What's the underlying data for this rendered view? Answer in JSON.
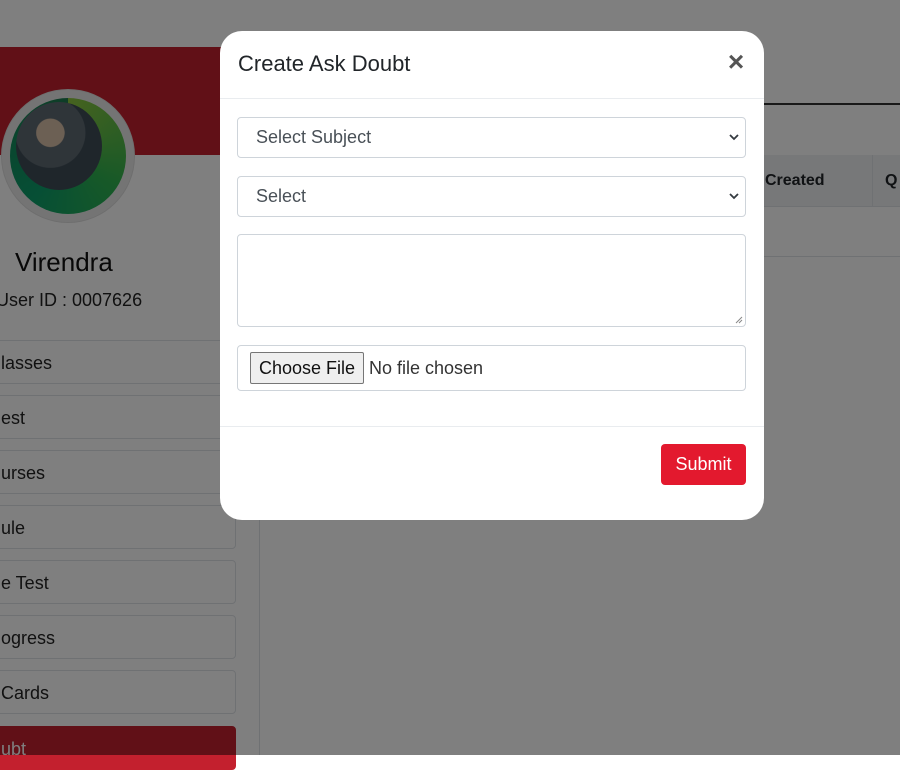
{
  "profile": {
    "name": "Virendra",
    "user_id": "User ID : 0007626"
  },
  "sidebar": {
    "items": [
      {
        "label": "lasses"
      },
      {
        "label": "est"
      },
      {
        "label": "urses"
      },
      {
        "label": "ule"
      },
      {
        "label": "e Test"
      },
      {
        "label": "ogress"
      },
      {
        "label": "Cards"
      },
      {
        "label": "ubt"
      }
    ]
  },
  "table": {
    "headers": [
      "Created",
      "Q"
    ]
  },
  "modal": {
    "title": "Create Ask Doubt",
    "close_glyph": "×",
    "subject_select": "Select Subject",
    "second_select": "Select",
    "textarea_value": "",
    "file_button": "Choose File",
    "file_status": "No file chosen",
    "submit_label": "Submit"
  },
  "colors": {
    "brand_red": "#c3202e",
    "submit_red": "#e3192e"
  }
}
